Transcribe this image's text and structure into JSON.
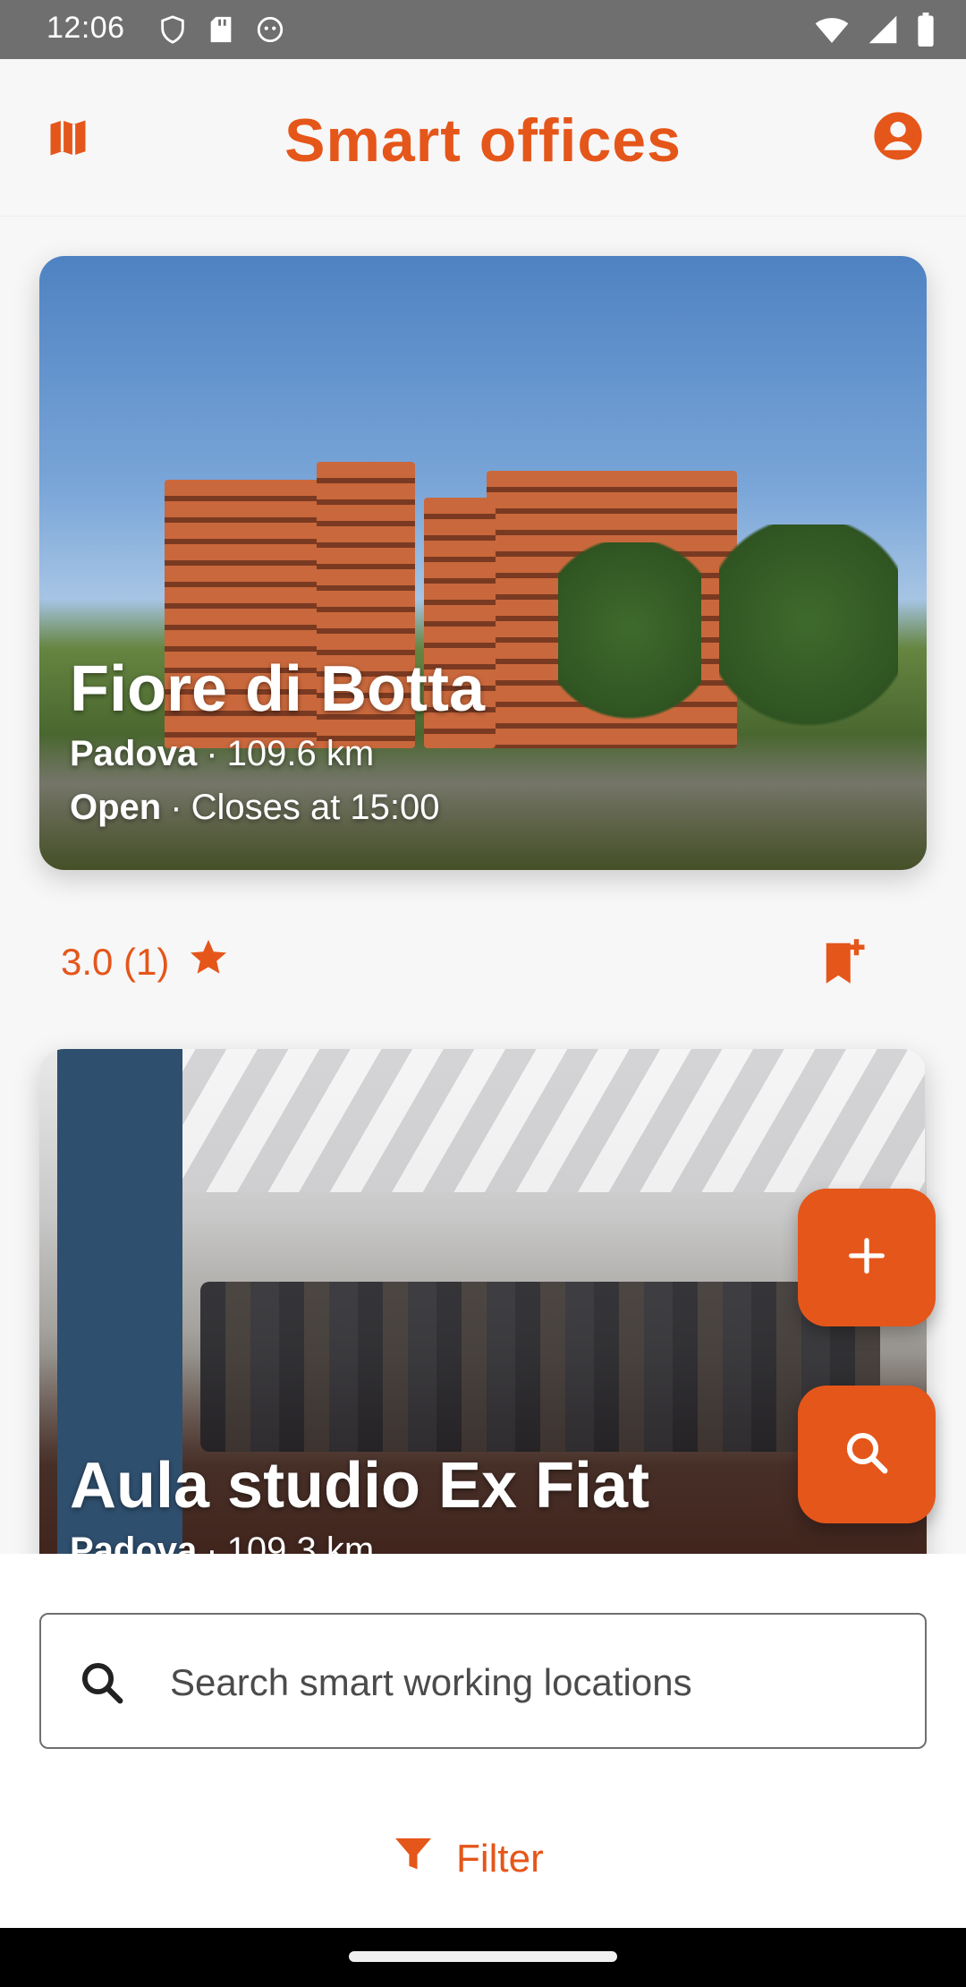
{
  "status_bar": {
    "time": "12:06",
    "left_icons": [
      "shield-icon",
      "sd-card-icon",
      "android-debug-icon"
    ],
    "right_icons": [
      "wifi-icon",
      "signal-icon",
      "battery-icon"
    ]
  },
  "app_bar": {
    "title": "Smart offices",
    "left_icon": "map-icon",
    "right_icon": "account-icon",
    "accent_color": "#e5561a"
  },
  "places": [
    {
      "name": "Fiore di Botta",
      "city": "Padova",
      "distance": "109.6 km",
      "status": "Open",
      "hours": "Closes at 15:00",
      "rating": "3.0 (1)",
      "icons": [
        "star-icon",
        "bookmark-add-icon"
      ]
    },
    {
      "name": "Aula studio Ex Fiat",
      "city": "Padova",
      "distance": "109.3 km"
    }
  ],
  "fabs": {
    "add_icon": "plus-icon",
    "search_icon": "search-icon"
  },
  "search": {
    "placeholder": "Search smart working locations",
    "value": ""
  },
  "filter": {
    "label": "Filter",
    "icon": "filter-icon"
  },
  "separator": "·"
}
